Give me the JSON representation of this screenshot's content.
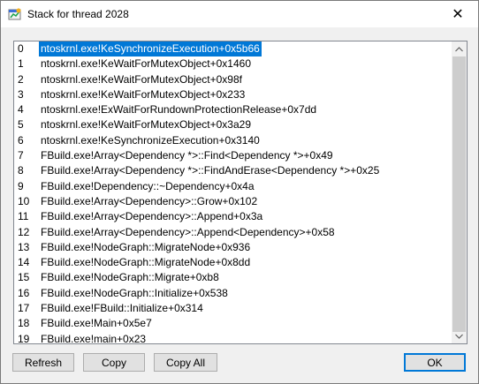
{
  "window": {
    "title": "Stack for thread 2028",
    "close_glyph": "✕"
  },
  "stack": {
    "selected_index": 0,
    "frames": [
      {
        "index": "0",
        "text": "ntoskrnl.exe!KeSynchronizeExecution+0x5b66"
      },
      {
        "index": "1",
        "text": "ntoskrnl.exe!KeWaitForMutexObject+0x1460"
      },
      {
        "index": "2",
        "text": "ntoskrnl.exe!KeWaitForMutexObject+0x98f"
      },
      {
        "index": "3",
        "text": "ntoskrnl.exe!KeWaitForMutexObject+0x233"
      },
      {
        "index": "4",
        "text": "ntoskrnl.exe!ExWaitForRundownProtectionRelease+0x7dd"
      },
      {
        "index": "5",
        "text": "ntoskrnl.exe!KeWaitForMutexObject+0x3a29"
      },
      {
        "index": "6",
        "text": "ntoskrnl.exe!KeSynchronizeExecution+0x3140"
      },
      {
        "index": "7",
        "text": "FBuild.exe!Array<Dependency *>::Find<Dependency *>+0x49"
      },
      {
        "index": "8",
        "text": "FBuild.exe!Array<Dependency *>::FindAndErase<Dependency *>+0x25"
      },
      {
        "index": "9",
        "text": "FBuild.exe!Dependency::~Dependency+0x4a"
      },
      {
        "index": "10",
        "text": "FBuild.exe!Array<Dependency>::Grow+0x102"
      },
      {
        "index": "11",
        "text": "FBuild.exe!Array<Dependency>::Append+0x3a"
      },
      {
        "index": "12",
        "text": "FBuild.exe!Array<Dependency>::Append<Dependency>+0x58"
      },
      {
        "index": "13",
        "text": "FBuild.exe!NodeGraph::MigrateNode+0x936"
      },
      {
        "index": "14",
        "text": "FBuild.exe!NodeGraph::MigrateNode+0x8dd"
      },
      {
        "index": "15",
        "text": "FBuild.exe!NodeGraph::Migrate+0xb8"
      },
      {
        "index": "16",
        "text": "FBuild.exe!NodeGraph::Initialize+0x538"
      },
      {
        "index": "17",
        "text": "FBuild.exe!FBuild::Initialize+0x314"
      },
      {
        "index": "18",
        "text": "FBuild.exe!Main+0x5e7"
      },
      {
        "index": "19",
        "text": "FBuild.exe!main+0x23"
      }
    ]
  },
  "buttons": {
    "refresh": "Refresh",
    "copy": "Copy",
    "copy_all": "Copy All",
    "ok": "OK"
  },
  "icons": {
    "app": "process-explorer-icon",
    "scroll_up": "scroll-up-arrow-icon",
    "scroll_down": "scroll-down-arrow-icon",
    "close": "close-icon"
  },
  "colors": {
    "selection": "#0078d7",
    "window_bg": "#f0f0f0",
    "list_bg": "#ffffff"
  }
}
